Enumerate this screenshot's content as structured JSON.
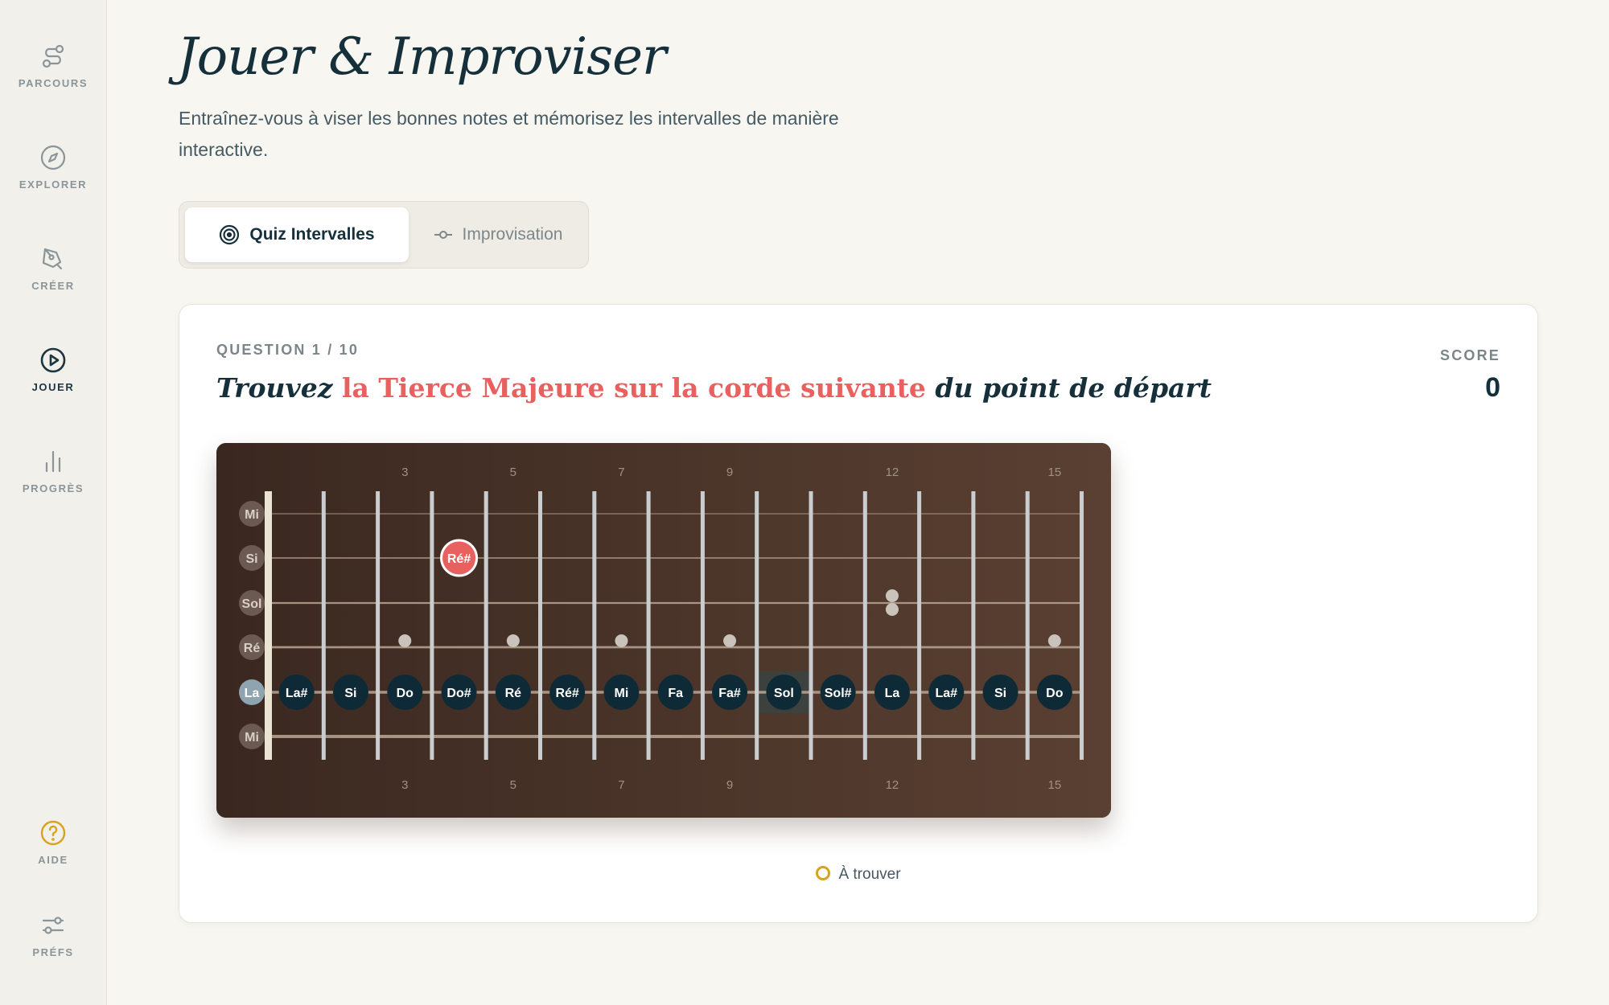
{
  "nav": {
    "items": [
      {
        "label": "PARCOURS",
        "icon": "route-icon"
      },
      {
        "label": "EXPLORER",
        "icon": "compass-icon"
      },
      {
        "label": "CRÉER",
        "icon": "pen-icon"
      },
      {
        "label": "JOUER",
        "icon": "play-icon",
        "active": true
      },
      {
        "label": "PROGRÈS",
        "icon": "bar-chart-icon"
      }
    ],
    "bottom": [
      {
        "label": "AIDE",
        "icon": "help-icon"
      },
      {
        "label": "PRÉFS",
        "icon": "sliders-icon"
      }
    ]
  },
  "header": {
    "title": "Jouer & Improviser",
    "subtitle": "Entraînez-vous à viser les bonnes notes et mémorisez les intervalles de manière interactive."
  },
  "tabs": [
    {
      "label": "Quiz Intervalles",
      "icon": "target-icon",
      "active": true
    },
    {
      "label": "Improvisation",
      "icon": "node-icon",
      "active": false
    }
  ],
  "quiz": {
    "question_counter": "QUESTION 1 / 10",
    "prompt_start": "Trouvez ",
    "prompt_highlight": "la Tierce Majeure sur la corde suivante",
    "prompt_end": " du point de départ",
    "score_label": "SCORE",
    "score_value": "0"
  },
  "fretboard": {
    "strings": [
      "Mi",
      "Si",
      "Sol",
      "Ré",
      "La",
      "Mi"
    ],
    "active_string": "La",
    "fret_markers": [
      "3",
      "5",
      "7",
      "9",
      "12",
      "15"
    ],
    "start_note": {
      "label": "Ré#",
      "string": "Si",
      "fret": 4
    },
    "highlighted_fret": 10,
    "row_notes": [
      "La#",
      "Si",
      "Do",
      "Do#",
      "Ré",
      "Ré#",
      "Mi",
      "Fa",
      "Fa#",
      "Sol",
      "Sol#",
      "La",
      "La#",
      "Si",
      "Do"
    ],
    "colors": {
      "board": "#4a3328",
      "note_bg": "#0e2a36",
      "start_note": "#e8605f",
      "string_label": "#6b5a52",
      "active_string_label": "#8ea4b0"
    }
  },
  "legend": {
    "label": "À trouver",
    "color": "#d9a21c"
  }
}
